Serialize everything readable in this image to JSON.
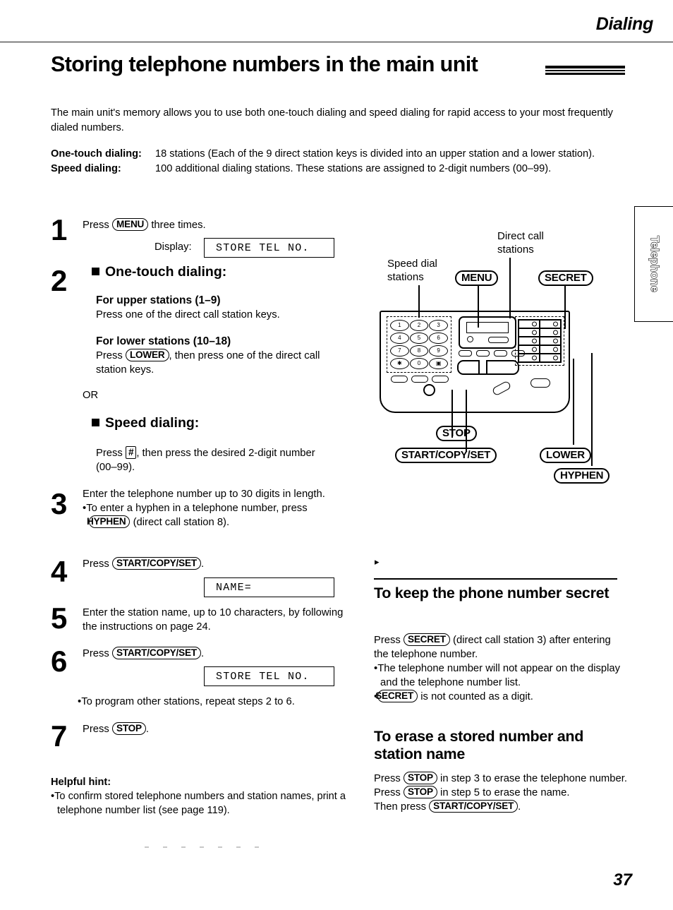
{
  "header": {
    "running_head": "Dialing",
    "title": "Storing telephone numbers in the main unit"
  },
  "intro": {
    "paragraph": "The main unit's memory allows you to use both one-touch dialing and speed dialing for rapid access to your most frequently dialed numbers."
  },
  "definitions": [
    {
      "term": "One-touch dialing:",
      "description": "18 stations (Each of the 9 direct station keys is divided into an upper station and a lower station)."
    },
    {
      "term": "Speed dialing:",
      "description": "100 additional dialing stations. These stations are assigned to 2-digit numbers (00–99)."
    }
  ],
  "steps": {
    "step1": {
      "number": "1",
      "text_before": "Press",
      "key": "MENU",
      "text_after": "three times.",
      "display_label": "Display:",
      "display_value": "STORE TEL NO."
    },
    "step2": {
      "number": "2",
      "onetouch_heading": "One-touch dialing:",
      "upper_heading": "For upper stations (1–9)",
      "upper_body": "Press one of the direct call station keys.",
      "lower_heading": "For lower stations (10–18)",
      "lower_before": "Press",
      "lower_key": "LOWER",
      "lower_after": ", then press one of the direct call station keys.",
      "or": "OR",
      "speed_heading": "Speed dialing:",
      "speed_before": "Press",
      "speed_key": "#",
      "speed_after": ", then press the desired 2-digit number (00–99)."
    },
    "step3": {
      "number": "3",
      "text": "Enter the telephone number up to 30 digits in length.",
      "bullet_before": "To enter a hyphen in a telephone number, press",
      "bullet_key": "HYPHEN",
      "bullet_after": "(direct call station 8)."
    },
    "step4": {
      "number": "4",
      "text_before": "Press",
      "key": "START/COPY/SET",
      "text_after": ".",
      "display_value": "NAME="
    },
    "step5": {
      "number": "5",
      "text": "Enter the station name, up to 10 characters, by following the instructions on page 24."
    },
    "step6": {
      "number": "6",
      "text_before": "Press",
      "key": "START/COPY/SET",
      "text_after": ".",
      "display_value": "STORE TEL NO.",
      "bullet": "To program other stations, repeat steps 2 to 6."
    },
    "step7": {
      "number": "7",
      "text_before": "Press",
      "key": "STOP",
      "text_after": "."
    }
  },
  "helpful_hint": {
    "heading": "Helpful hint:",
    "bullet": "To confirm stored telephone numbers and station names, print a telephone number list (see page 119)."
  },
  "diagram": {
    "callouts": {
      "speed_dial": "Speed dial\nstations",
      "direct_call": "Direct call\nstations",
      "menu": "MENU",
      "secret": "SECRET",
      "stop": "STOP",
      "start_copy_set": "START/COPY/SET",
      "lower": "LOWER",
      "hyphen": "HYPHEN"
    },
    "keypad_keys": [
      "1",
      "2",
      "3",
      "4",
      "5",
      "6",
      "7",
      "8",
      "9",
      "✱",
      "0",
      "▣"
    ]
  },
  "secret_section": {
    "heading": "To keep the phone number secret",
    "body_before": "Press",
    "body_key": "SECRET",
    "body_after": "(direct call station 3) after entering the telephone number.",
    "bullet1": "The telephone number will not appear on the display and the telephone number list.",
    "bullet2_key": "SECRET",
    "bullet2_after": "is not counted as a digit."
  },
  "erase_section": {
    "heading": "To erase a stored number and station name",
    "before1": "Press",
    "key1": "STOP",
    "mid1": "in step 3 to erase the telephone number. Press",
    "key2": "STOP",
    "mid2": "in step 5 to erase the name.",
    "before3": "Then press",
    "key3": "START/COPY/SET",
    "after3": "."
  },
  "side_tab": {
    "label": "Telephone"
  },
  "footer": {
    "page_number": "37"
  }
}
